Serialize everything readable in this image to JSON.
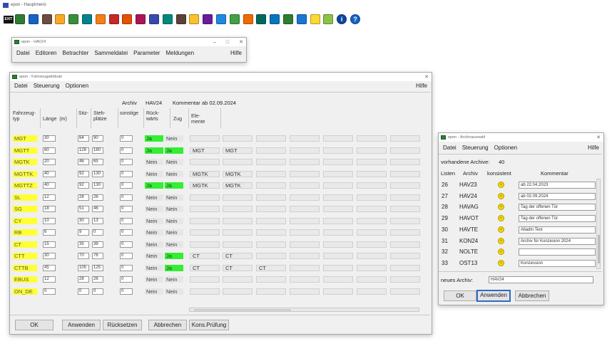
{
  "main": {
    "title": "epon - Hauptmenü"
  },
  "toolbar": {
    "exit_label": "EXIT",
    "icons": [
      "grid-icon",
      "tools-icon",
      "lines-icon",
      "bus-icon",
      "map-icon",
      "table-icon",
      "note-icon",
      "graph-icon",
      "rocket-icon",
      "butterfly-icon",
      "route-icon",
      "chart-icon",
      "network-icon",
      "vehicle-icon",
      "building-icon",
      "list-icon",
      "pencil-icon",
      "split-icon",
      "world-icon",
      "tram-icon",
      "monitor-icon",
      "book-icon",
      "signal-icon",
      "coins-icon",
      "info-icon",
      "help-icon"
    ],
    "icon_colors": [
      "#2e7d32",
      "#1565c0",
      "#6d4c41",
      "#f9a825",
      "#388e3c",
      "#00838f",
      "#f57f17",
      "#c62828",
      "#e65100",
      "#ad1457",
      "#3949ab",
      "#00897b",
      "#5d4037",
      "#fbc02d",
      "#6a1b9a",
      "#1e88e5",
      "#43a047",
      "#ef6c00",
      "#00695c",
      "#0277bd",
      "#2e7d32",
      "#1976d2",
      "#fdd835",
      "#8bc34a",
      "#0d47a1",
      "#1565c0"
    ]
  },
  "hav24": {
    "title": "epon - HAV24",
    "menu": [
      "Datei",
      "Editoren",
      "Betrachter",
      "Sammeldatei",
      "Parameter",
      "Meldungen"
    ],
    "help": "Hilfe"
  },
  "fahrzeug": {
    "title": "epon - Fahrzeugattribute",
    "menu": [
      "Datei",
      "Steuerung",
      "Optionen"
    ],
    "help": "Hilfe",
    "archiv_label": "Archiv",
    "archiv_value": "HAV24",
    "kommentar_label": "Kommentar",
    "kommentar_value": "ab 02.09.2024",
    "headers": {
      "typ": "Fahrzeug-\ntyp",
      "laenge": "Länge  (m)",
      "sitz": "Sitz-",
      "steh": "Steh-\nplätze",
      "sonstige": "sonstige",
      "rueck": "Rück-\nwärts",
      "zug": "Zug",
      "elemente": "Ele-\nmente"
    },
    "rows": [
      {
        "typ": "MGT",
        "laenge": "30",
        "sitz": "64",
        "steh": "90",
        "sonst": "0",
        "rueck": "Ja",
        "zug": "Nein",
        "el": [
          "",
          ""
        ]
      },
      {
        "typ": "MGTT",
        "laenge": "60",
        "sitz": "128",
        "steh": "180",
        "sonst": "0",
        "rueck": "Ja",
        "zug": "Ja",
        "el": [
          "MGT",
          "MGT"
        ]
      },
      {
        "typ": "MGTK",
        "laenge": "20",
        "sitz": "46",
        "steh": "65",
        "sonst": "0",
        "rueck": "Nein",
        "zug": "Nein",
        "el": [
          "",
          ""
        ]
      },
      {
        "typ": "MGTTK",
        "laenge": "40",
        "sitz": "92",
        "steh": "130",
        "sonst": "0",
        "rueck": "Nein",
        "zug": "Nein",
        "el": [
          "MGTK",
          "MGTK"
        ]
      },
      {
        "typ": "MGTTZ",
        "laenge": "40",
        "sitz": "92",
        "steh": "130",
        "sonst": "0",
        "rueck": "Ja",
        "zug": "Ja",
        "el": [
          "MGTK",
          "MGTK"
        ]
      },
      {
        "typ": "SL",
        "laenge": "12",
        "sitz": "28",
        "steh": "26",
        "sonst": "0",
        "rueck": "Nein",
        "zug": "Nein",
        "el": [
          "",
          ""
        ]
      },
      {
        "typ": "SG",
        "laenge": "18",
        "sitz": "51",
        "steh": "46",
        "sonst": "0",
        "rueck": "Nein",
        "zug": "Nein",
        "el": [
          "",
          ""
        ]
      },
      {
        "typ": "CY",
        "laenge": "10",
        "sitz": "30",
        "steh": "13",
        "sonst": "0",
        "rueck": "Nein",
        "zug": "Nein",
        "el": [
          "",
          ""
        ]
      },
      {
        "typ": "RB",
        "laenge": "6",
        "sitz": "9",
        "steh": "0",
        "sonst": "0",
        "rueck": "Nein",
        "zug": "Nein",
        "el": [
          "",
          ""
        ]
      },
      {
        "typ": "CT",
        "laenge": "15",
        "sitz": "35",
        "steh": "38",
        "sonst": "0",
        "rueck": "Nein",
        "zug": "Nein",
        "el": [
          "",
          ""
        ]
      },
      {
        "typ": "CTT",
        "laenge": "30",
        "sitz": "70",
        "steh": "76",
        "sonst": "0",
        "rueck": "Nein",
        "zug": "Ja",
        "el": [
          "CT",
          "CT"
        ]
      },
      {
        "typ": "CTTB",
        "laenge": "45",
        "sitz": "105",
        "steh": "125",
        "sonst": "0",
        "rueck": "Nein",
        "zug": "Ja",
        "el": [
          "CT",
          "CT",
          "CT"
        ]
      },
      {
        "typ": "EBUS",
        "laenge": "12",
        "sitz": "28",
        "steh": "26",
        "sonst": "0",
        "rueck": "Nein",
        "zug": "Nein",
        "el": [
          "",
          ""
        ]
      },
      {
        "typ": "ON_DE",
        "laenge": "0",
        "sitz": "0",
        "steh": "0",
        "sonst": "0",
        "rueck": "Nein",
        "zug": "Nein",
        "el": [
          "",
          ""
        ]
      }
    ],
    "buttons": [
      "OK",
      "Anwenden",
      "Rücksetzen",
      "Abbrechen",
      "Kons.Prüfung"
    ]
  },
  "archiv": {
    "title": "epon - Archivauswahl",
    "menu": [
      "Datei",
      "Steuerung",
      "Optionen"
    ],
    "help": "Hilfe",
    "count_label": "vorhandene Archive:",
    "count_value": "40",
    "headers": [
      "Listen",
      "Archiv",
      "konsistent",
      "Kommentar"
    ],
    "rows": [
      {
        "nr": "26",
        "name": "HAV23",
        "komm": "ab 22.04.2023"
      },
      {
        "nr": "27",
        "name": "HAV24",
        "komm": "ab 02.09.2024"
      },
      {
        "nr": "28",
        "name": "HAVAG",
        "komm": "Tag der offenen Tür"
      },
      {
        "nr": "29",
        "name": "HAVOT",
        "komm": "Tag der offenen Tür"
      },
      {
        "nr": "30",
        "name": "HAVTE",
        "komm": "Alladin Test"
      },
      {
        "nr": "31",
        "name": "KON24",
        "komm": "Archiv für Konzesion 2024"
      },
      {
        "nr": "32",
        "name": "NOLTE",
        "komm": ""
      },
      {
        "nr": "33",
        "name": "OST13",
        "komm": "Konzession"
      }
    ],
    "smiley": "☺",
    "new_label": "neues Archiv:",
    "new_value": "HAV24",
    "buttons": [
      "OK",
      "Anwenden",
      "Abbrechen"
    ]
  }
}
